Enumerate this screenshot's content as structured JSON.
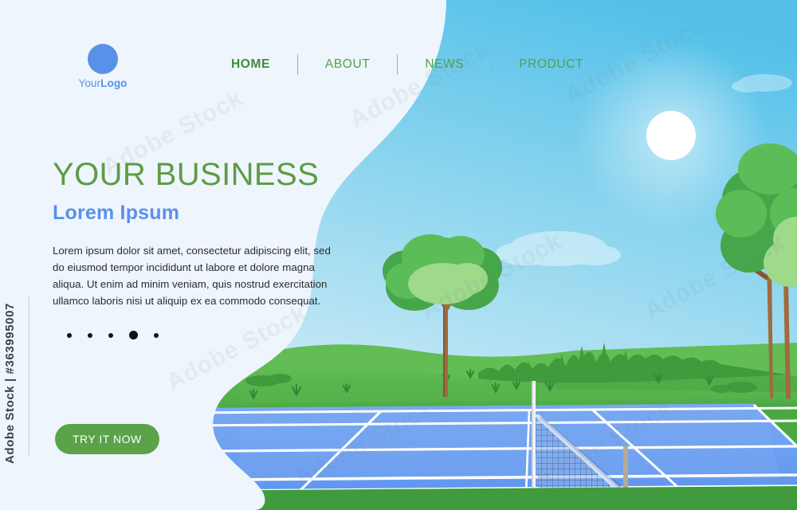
{
  "brand": {
    "logo_icon": "circle-logo-icon",
    "logo_text_light": "Your",
    "logo_text_bold": "Logo",
    "logo_color": "#5a91e8"
  },
  "nav": {
    "items": [
      {
        "label": "HOME",
        "active": true
      },
      {
        "label": "ABOUT",
        "active": false
      },
      {
        "label": "NEWS",
        "active": false
      },
      {
        "label": "PRODUCT",
        "active": false
      }
    ],
    "link_color": "#53a14a",
    "active_color": "#3f8c36"
  },
  "hero": {
    "headline": "YOUR BUSINESS",
    "headline_color": "#5f9b45",
    "subheadline": "Lorem Ipsum",
    "subheadline_color": "#5a91e8",
    "body": "Lorem ipsum dolor sit amet, consectetur adipiscing elit, sed do eiusmod tempor incididunt ut labore et dolore magna aliqua. Ut enim ad minim veniam, quis nostrud exercitation ullamco laboris nisi ut aliquip ex ea commodo consequat.",
    "cta_label": "TRY IT NOW",
    "cta_color": "#5aa349"
  },
  "carousel": {
    "total_dots": 5,
    "active_index": 3
  },
  "watermark": {
    "stock_id": "Adobe Stock | #363995007",
    "tile_text": "Adobe Stock"
  },
  "illustration": {
    "scene": "tennis-court-landscape",
    "sky_top_color": "#5cc3e8",
    "sky_bottom_color": "#cfeaf6",
    "sun_color": "#ffffff",
    "grass_light": "#6ec25a",
    "grass_mid": "#4fae47",
    "grass_dark": "#3f9b3c",
    "court_color": "#6b9ff0",
    "court_line_color": "#ffffff",
    "trunk_color": "#a06a3e",
    "foliage_dark": "#46a64a",
    "foliage_mid": "#5bbd57",
    "foliage_light": "#9fd98a",
    "panel_color": "#eef5fc"
  }
}
